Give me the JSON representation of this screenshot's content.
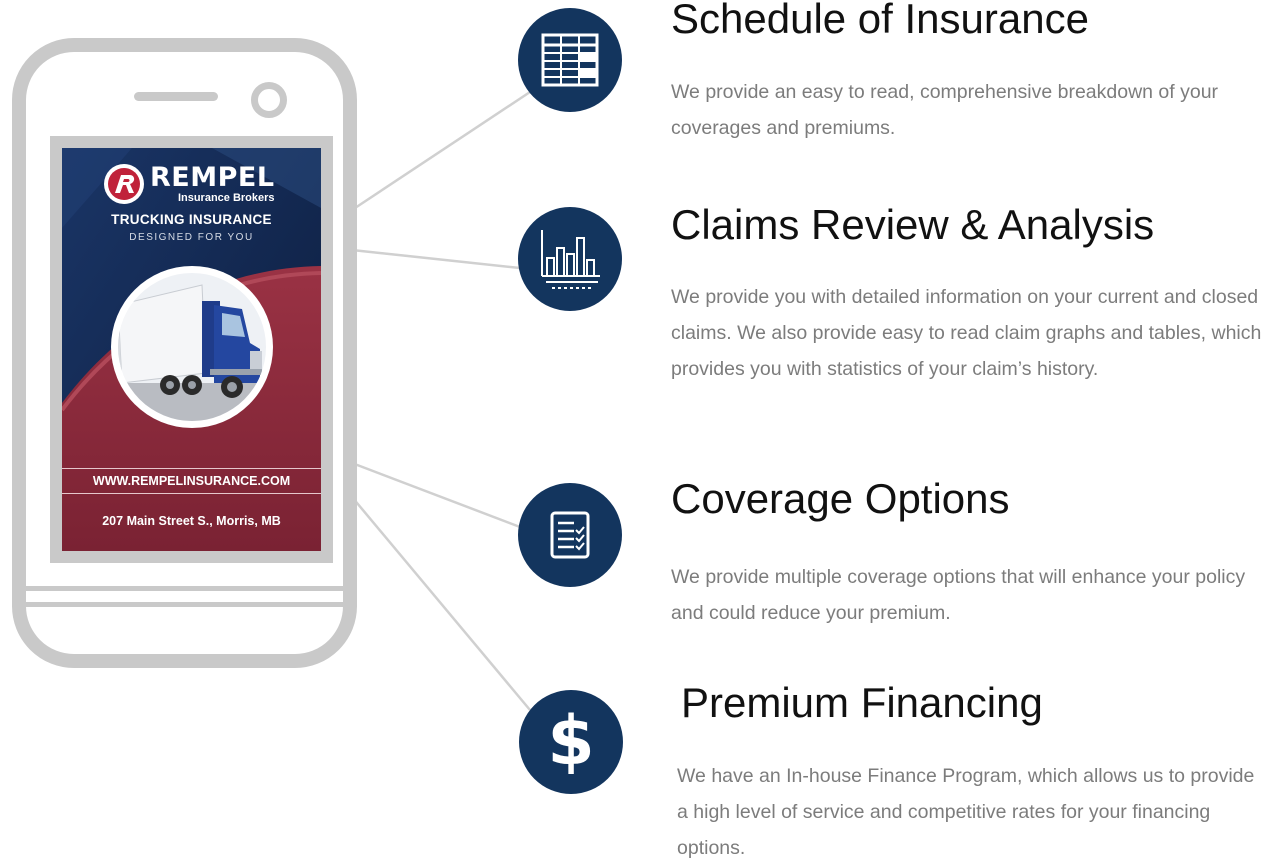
{
  "ad": {
    "brand_name": "REMPEL",
    "brand_sub": "Insurance Brokers",
    "tagline": "TRUCKING INSURANCE",
    "tagline_sub": "DESIGNED FOR YOU",
    "url": "WWW.REMPELINSURANCE.COM",
    "address": "207 Main Street S., Morris, MB"
  },
  "features": [
    {
      "icon": "table-icon",
      "title": "Schedule of Insurance",
      "description": "We provide an easy to read, comprehensive breakdown of your coverages and premiums."
    },
    {
      "icon": "bar-chart-icon",
      "title": "Claims Review & Analysis",
      "description": "We provide you with detailed information on your current and closed claims.  We also provide easy to read claim graphs and tables, which provides you with statistics of your claim’s history."
    },
    {
      "icon": "checklist-icon",
      "title": "Coverage Options",
      "description": "We provide multiple coverage options that will enhance your policy and could reduce your premium."
    },
    {
      "icon": "dollar-icon",
      "glyph": "$",
      "title": "Premium Financing",
      "description": "We have an In-house Finance Program, which allows us to provide a high level of service and competitive rates for your financing options."
    }
  ],
  "colors": {
    "icon_circle": "#13355e",
    "phone_frame": "#c9c9c9",
    "ad_navy": "#0f2245",
    "ad_maroon": "#8a2a3b",
    "heading": "#111111",
    "body_text": "#7c7c7c"
  }
}
